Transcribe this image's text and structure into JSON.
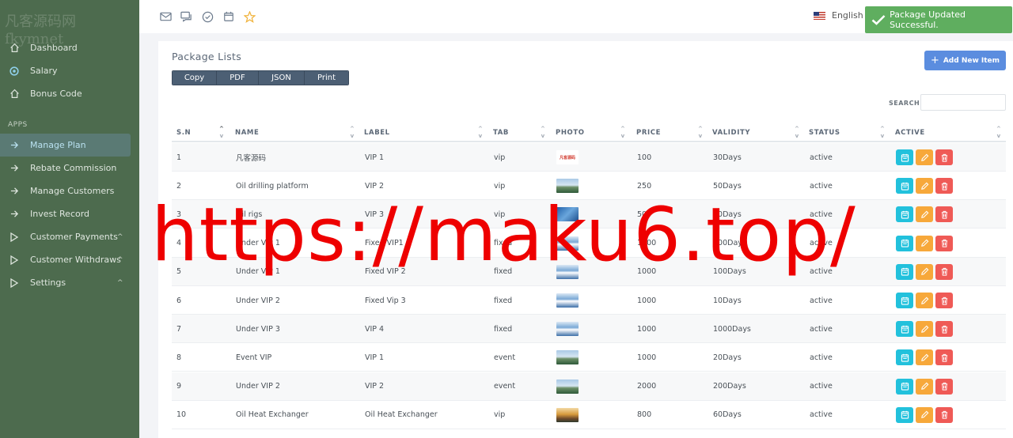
{
  "watermark": {
    "line1": "凡客源码网",
    "line2": "fkymnet"
  },
  "sidebar": {
    "items": [
      {
        "label": "Dashboard",
        "icon": "home-icon"
      },
      {
        "label": "Salary",
        "icon": "settings-icon"
      },
      {
        "label": "Bonus Code",
        "icon": "home-icon"
      }
    ],
    "section_label": "APPS",
    "apps": [
      {
        "label": "Manage Plan",
        "icon": "arrow-right-icon",
        "active": true
      },
      {
        "label": "Rebate Commission",
        "icon": "arrow-right-icon"
      },
      {
        "label": "Manage Customers",
        "icon": "arrow-right-icon"
      },
      {
        "label": "Invest Record",
        "icon": "arrow-right-icon"
      },
      {
        "label": "Customer Payments",
        "icon": "play-icon",
        "chevron": "^"
      },
      {
        "label": "Customer Withdraws",
        "icon": "play-icon",
        "chevron": "^"
      },
      {
        "label": "Settings",
        "icon": "play-icon",
        "chevron": "^"
      }
    ]
  },
  "topbar": {
    "icons": [
      "mail-icon",
      "chat-icon",
      "check-circle-icon",
      "calendar-icon",
      "star-icon"
    ],
    "language": "English"
  },
  "toast": {
    "message": "Package Updated Successful."
  },
  "page": {
    "title": "Package Lists",
    "export_buttons": [
      "Copy",
      "PDF",
      "JSON",
      "Print"
    ],
    "add_button": "Add New Item",
    "search_label": "SEARCH:",
    "search_value": "",
    "columns": [
      "S.N",
      "NAME",
      "LABEL",
      "TAB",
      "PHOTO",
      "PRICE",
      "VALIDITY",
      "STATUS",
      "ACTIVE"
    ],
    "rows": [
      {
        "sn": "1",
        "name": "凡客源码",
        "label": "VIP 1",
        "tab": "vip",
        "photo": "logo",
        "photo_text": "凡客源码",
        "price": "100",
        "validity": "30Days",
        "status": "active"
      },
      {
        "sn": "2",
        "name": "Oil drilling platform",
        "label": "VIP 2",
        "tab": "vip",
        "photo": "plant",
        "price": "250",
        "validity": "50Days",
        "status": "active"
      },
      {
        "sn": "3",
        "name": "Oil rigs",
        "label": "VIP 3",
        "tab": "vip",
        "photo": "blue",
        "price": "500",
        "validity": "50Days",
        "status": "active"
      },
      {
        "sn": "4",
        "name": "Under VIP 1",
        "label": "Fixed VIP1",
        "tab": "fixed",
        "photo": "sky",
        "price": "1000",
        "validity": "100Days",
        "status": "active"
      },
      {
        "sn": "5",
        "name": "Under VIP 1",
        "label": "Fixed VIP 2",
        "tab": "fixed",
        "photo": "sky",
        "price": "1000",
        "validity": "100Days",
        "status": "active"
      },
      {
        "sn": "6",
        "name": "Under VIP 2",
        "label": "Fixed Vip 3",
        "tab": "fixed",
        "photo": "sky",
        "price": "1000",
        "validity": "10Days",
        "status": "active"
      },
      {
        "sn": "7",
        "name": "Under VIP 3",
        "label": "VIP 4",
        "tab": "fixed",
        "photo": "sky",
        "price": "1000",
        "validity": "1000Days",
        "status": "active"
      },
      {
        "sn": "8",
        "name": "Event VIP",
        "label": "VIP 1",
        "tab": "event",
        "photo": "plant",
        "price": "1000",
        "validity": "20Days",
        "status": "active"
      },
      {
        "sn": "9",
        "name": "Under VIP 2",
        "label": "VIP 2",
        "tab": "event",
        "photo": "plant",
        "price": "2000",
        "validity": "200Days",
        "status": "active"
      },
      {
        "sn": "10",
        "name": "Oil Heat Exchanger",
        "label": "Oil Heat Exchanger",
        "tab": "vip",
        "photo": "sunset",
        "price": "800",
        "validity": "60Days",
        "status": "active"
      }
    ],
    "row_actions": [
      "view-icon",
      "edit-icon",
      "delete-icon"
    ]
  },
  "overlay": {
    "text": "https://maku6.top/"
  },
  "colors": {
    "sidebar_bg": "#4d6b4e",
    "toast_bg": "#5fae5f",
    "add_button": "#5b8ddf",
    "view_action": "#22c1dc",
    "edit_action": "#f7a83a",
    "delete_action": "#ef5a56",
    "overlay_text": "#ee0000"
  }
}
